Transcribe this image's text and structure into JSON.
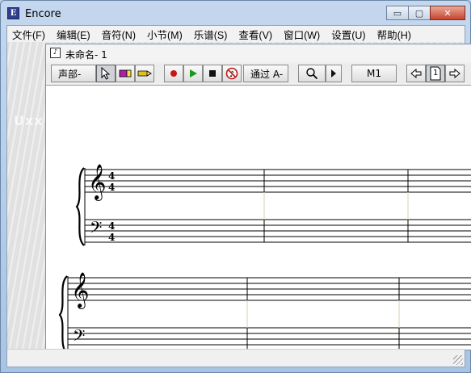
{
  "app": {
    "title": "Encore",
    "icon": "encore-app-icon",
    "icon_glyph": "E"
  },
  "caption_buttons": {
    "minimize": "▭",
    "maximize": "▢",
    "close": "✕"
  },
  "menu": {
    "items": [
      {
        "label": "文件(F)"
      },
      {
        "label": "编辑(E)"
      },
      {
        "label": "音符(N)"
      },
      {
        "label": "小节(M)"
      },
      {
        "label": "乐谱(S)"
      },
      {
        "label": "查看(V)"
      },
      {
        "label": "窗口(W)"
      },
      {
        "label": "设置(U)"
      },
      {
        "label": "帮助(H)"
      }
    ]
  },
  "background": {
    "watermark": "Uxx"
  },
  "document": {
    "title": "未命名- 1",
    "icon": "document-icon",
    "icon_glyph": "♪"
  },
  "toolbar": {
    "voice_label": "声部-",
    "pass_label": "通过 A-",
    "measure_label": "M1",
    "page_number": "1",
    "icons": {
      "pointer": "pointer-arrow-icon",
      "eraser": "eraser-icon",
      "pencil": "pencil-icon",
      "record": "record-icon",
      "play": "play-icon",
      "stop": "stop-icon",
      "mute": "mute-icon",
      "zoom": "magnifier-icon",
      "next": "triangle-right-icon",
      "page_prev": "arrow-left-icon",
      "page": "page-icon",
      "page_next": "arrow-right-icon"
    },
    "colors": {
      "record": "#c41818",
      "play": "#1a9a1a",
      "eraser": "#b21ea8",
      "pencil": "#e0c21a"
    }
  },
  "score": {
    "systems": [
      {
        "staves": [
          "treble",
          "bass"
        ],
        "time_signature": "4/4",
        "measures_visible": 3
      },
      {
        "staves": [
          "treble",
          "bass"
        ],
        "measures_visible": 3
      }
    ]
  }
}
